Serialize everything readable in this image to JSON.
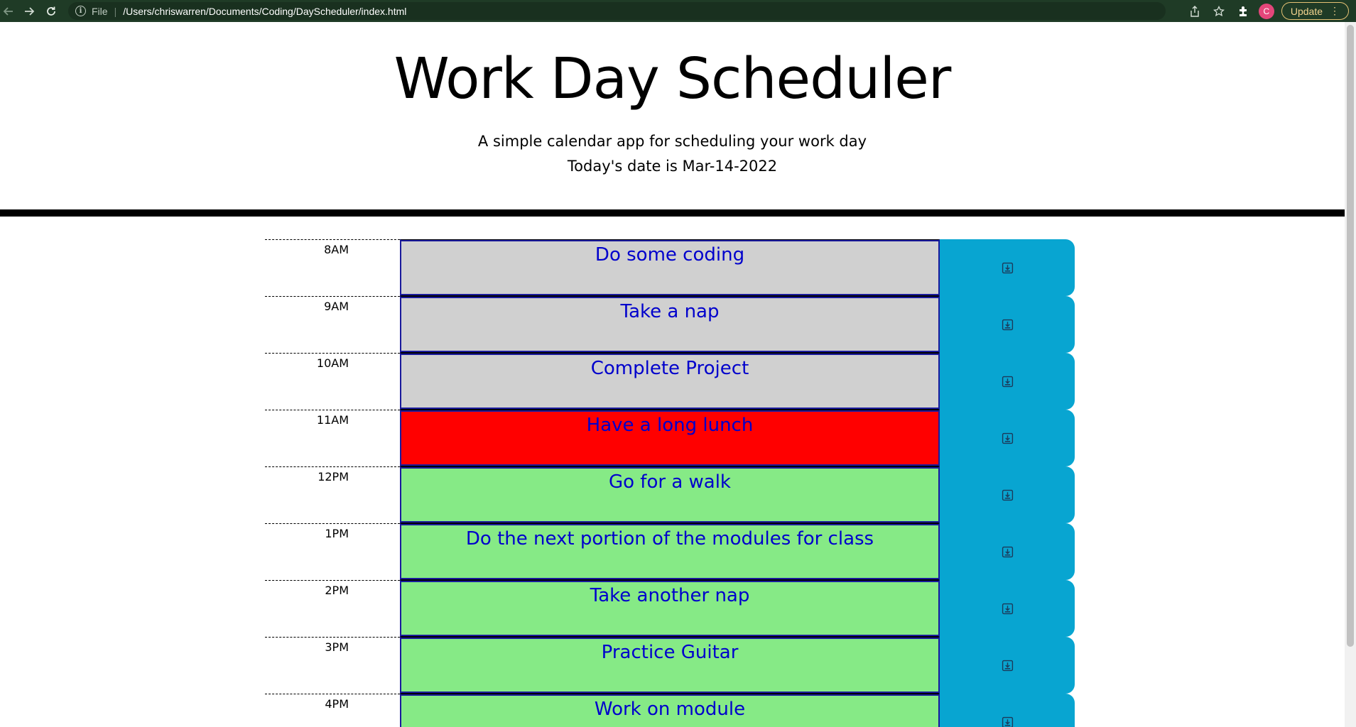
{
  "browser": {
    "file_label": "File",
    "separator": "|",
    "url": "/Users/chriswarren/Documents/Coding/DayScheduler/index.html",
    "avatar_letter": "C",
    "update_label": "Update",
    "icons": [
      "back-arrow-icon",
      "forward-arrow-icon",
      "reload-icon",
      "info-icon",
      "share-icon",
      "star-icon",
      "extensions-icon",
      "kebab-menu-icon"
    ]
  },
  "header": {
    "title": "Work Day Scheduler",
    "subtitle": "A simple calendar app for scheduling your work day",
    "date_line": "Today's date is Mar-14-2022"
  },
  "colors": {
    "past": "#d0d0d0",
    "present": "#ff0000",
    "future": "#86ea86",
    "save_button": "#08a5d1",
    "task_text": "#0000cc",
    "browser_bar": "#1f3b26"
  },
  "schedule": [
    {
      "hour": "8AM",
      "task": "Do some coding",
      "status": "past"
    },
    {
      "hour": "9AM",
      "task": "Take a nap",
      "status": "past"
    },
    {
      "hour": "10AM",
      "task": "Complete Project",
      "status": "past"
    },
    {
      "hour": "11AM",
      "task": "Have a long lunch",
      "status": "present"
    },
    {
      "hour": "12PM",
      "task": "Go for a walk",
      "status": "future"
    },
    {
      "hour": "1PM",
      "task": "Do the next portion of the modules for class",
      "status": "future"
    },
    {
      "hour": "2PM",
      "task": "Take another nap",
      "status": "future"
    },
    {
      "hour": "3PM",
      "task": "Practice Guitar",
      "status": "future"
    },
    {
      "hour": "4PM",
      "task": "Work on module",
      "status": "future"
    }
  ]
}
